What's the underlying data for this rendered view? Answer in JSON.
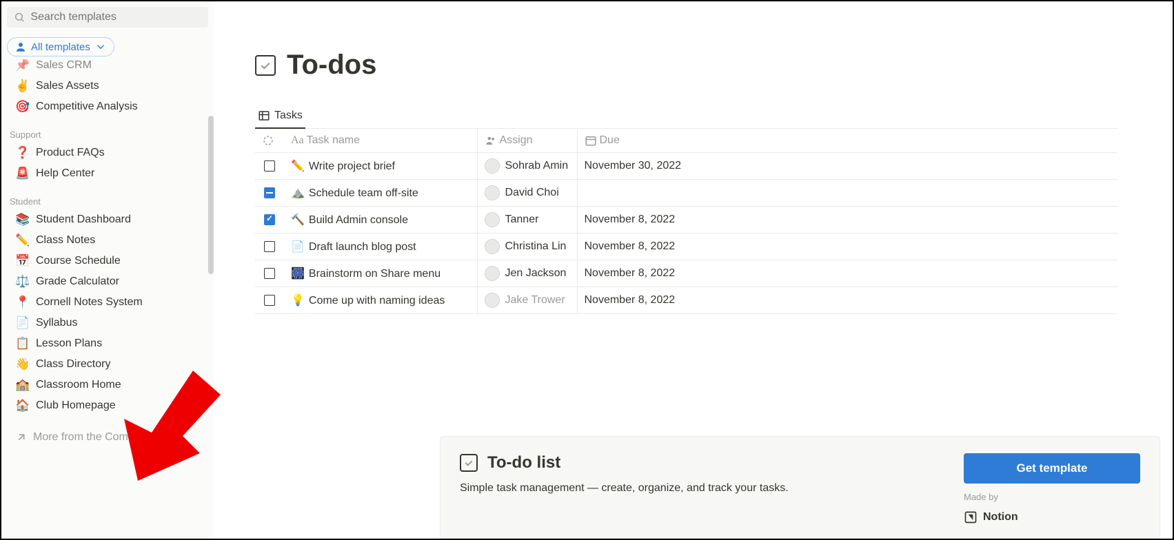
{
  "search_placeholder": "Search templates",
  "filter_label": "All templates",
  "sidebar": {
    "top_items": [
      {
        "emoji": "📌",
        "label": "Sales CRM"
      },
      {
        "emoji": "✌️",
        "label": "Sales Assets"
      },
      {
        "emoji": "🎯",
        "label": "Competitive Analysis"
      }
    ],
    "sections": [
      {
        "heading": "Support",
        "items": [
          {
            "emoji": "❓",
            "label": "Product FAQs"
          },
          {
            "emoji": "🚨",
            "label": "Help Center"
          }
        ]
      },
      {
        "heading": "Student",
        "items": [
          {
            "emoji": "📚",
            "label": "Student Dashboard"
          },
          {
            "emoji": "✏️",
            "label": "Class Notes"
          },
          {
            "emoji": "📅",
            "label": "Course Schedule"
          },
          {
            "emoji": "⚖️",
            "label": "Grade Calculator"
          },
          {
            "emoji": "📍",
            "label": "Cornell Notes System"
          },
          {
            "emoji": "📄",
            "label": "Syllabus"
          },
          {
            "emoji": "📋",
            "label": "Lesson Plans"
          },
          {
            "emoji": "👋",
            "label": "Class Directory"
          },
          {
            "emoji": "🏫",
            "label": "Classroom Home"
          },
          {
            "emoji": "🏠",
            "label": "Club Homepage"
          }
        ]
      }
    ],
    "footer_label": "More from the Community"
  },
  "page": {
    "title": "To-dos",
    "tab_label": "Tasks",
    "columns": {
      "name": "Task name",
      "assign": "Assign",
      "due": "Due"
    },
    "rows": [
      {
        "check": "empty",
        "emoji": "✏️",
        "name": "Write project brief",
        "assign": "Sohrab Amin",
        "faded": false,
        "due": "November 30, 2022"
      },
      {
        "check": "minus",
        "emoji": "⛰️",
        "name": "Schedule team off-site",
        "assign": "David Choi",
        "faded": false,
        "due": ""
      },
      {
        "check": "checked",
        "emoji": "🔨",
        "name": "Build Admin console",
        "assign": "Tanner",
        "faded": false,
        "due": "November 8, 2022"
      },
      {
        "check": "empty",
        "emoji": "📄",
        "name": "Draft launch blog post",
        "assign": "Christina Lin",
        "faded": false,
        "due": "November 8, 2022"
      },
      {
        "check": "empty",
        "emoji": "🎆",
        "name": "Brainstorm on Share menu",
        "assign": "Jen Jackson",
        "faded": false,
        "due": "November 8, 2022"
      },
      {
        "check": "empty",
        "emoji": "💡",
        "name": "Come up with naming ideas",
        "assign": "Jake Trower",
        "faded": true,
        "due": "November 8, 2022"
      }
    ]
  },
  "footer": {
    "title": "To-do list",
    "desc": "Simple task management — create, organize, and track your tasks.",
    "button": "Get template",
    "made_by_label": "Made by",
    "maker": "Notion"
  }
}
